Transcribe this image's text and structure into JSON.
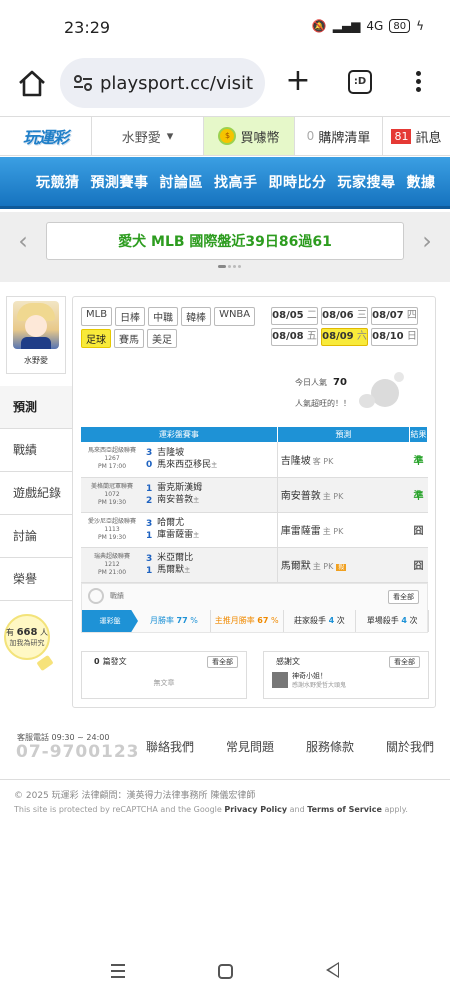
{
  "status": {
    "time": "23:29",
    "battery": "80",
    "net": "4G"
  },
  "browser": {
    "url": "playsport.cc/visit",
    "tabs_label": ":D"
  },
  "header": {
    "logo": "玩運彩",
    "username": "水野愛",
    "buy_coin": "買噱幣",
    "cart_count": "0",
    "cart_label": "購牌清單",
    "msg_count": "81",
    "msg_label": "訊息"
  },
  "nav": [
    "玩競猜",
    "預測賽事",
    "討論區",
    "找高手",
    "即時比分",
    "玩家搜尋",
    "數據"
  ],
  "banner": {
    "text": "愛犬 MLB 國際盤近39日86過61"
  },
  "sidebar": {
    "name": "水野愛",
    "items": [
      "預測",
      "戰績",
      "遊戲紀錄",
      "討論",
      "榮譽"
    ],
    "counter_prefix": "有",
    "counter_value": "668",
    "counter_suffix": "人",
    "counter_line2": "加我為研究"
  },
  "leagues": [
    "MLB",
    "日棒",
    "中職",
    "韓棒",
    "WNBA",
    "足球",
    "賽馬",
    "美足"
  ],
  "active_league": "足球",
  "dates": [
    {
      "date": "08/05",
      "day": "二"
    },
    {
      "date": "08/06",
      "day": "三"
    },
    {
      "date": "08/07",
      "day": "四"
    },
    {
      "date": "08/08",
      "day": "五"
    },
    {
      "date": "08/09",
      "day": "六"
    },
    {
      "date": "08/10",
      "day": "日"
    }
  ],
  "active_date": "08/09",
  "popularity": {
    "label": "今日人氣",
    "value": "70",
    "line2": "人氣超旺的！！"
  },
  "table": {
    "headers": [
      "運彩盤賽事",
      "預測",
      "結果"
    ],
    "rows": [
      {
        "league": "馬來西亞超級聯賽",
        "id": "1267",
        "time": "PM 17:00",
        "s1": "3",
        "s2": "0",
        "t1": "吉隆坡",
        "t2": "馬來西亞移民",
        "t2note": "主",
        "pick": "吉隆坡",
        "pick_note": "客 PK",
        "tag": "",
        "result": "準"
      },
      {
        "league": "美格蘭冠軍聯賽",
        "id": "1072",
        "time": "PM 19:30",
        "s1": "1",
        "s2": "2",
        "t1": "雷克斯漢姆",
        "t2": "南安普敦",
        "t2note": "主",
        "pick": "南安普敦",
        "pick_note": "主 PK",
        "tag": "",
        "result": "準"
      },
      {
        "league": "愛沙尼亞超級聯賽",
        "id": "1113",
        "time": "PM 19:30",
        "s1": "3",
        "s2": "1",
        "t1": "哈爾尤",
        "t2": "庫雷薩雷",
        "t2note": "主",
        "pick": "庫雷薩雷",
        "pick_note": "主 PK",
        "tag": "",
        "result": "囧"
      },
      {
        "league": "瑞典超級聯賽",
        "id": "1212",
        "time": "PM 21:00",
        "s1": "3",
        "s2": "1",
        "t1": "米亞爾比",
        "t2": "馬爾默",
        "t2note": "主",
        "pick": "馬爾默",
        "pick_note": "主 PK",
        "tag": "殺",
        "result": "囧"
      }
    ]
  },
  "stats": {
    "title": "戰績",
    "all": "看全部",
    "label": "運彩盤",
    "cells": [
      {
        "name": "月勝率",
        "value": "77",
        "unit": "%"
      },
      {
        "name": "主推月勝率",
        "value": "67",
        "unit": "%"
      },
      {
        "name": "莊家殺手",
        "value": "4",
        "unit": "次"
      },
      {
        "name": "單場殺手",
        "value": "4",
        "unit": "次"
      }
    ]
  },
  "posts": {
    "count": "0",
    "label": "篇發文",
    "all": "看全部",
    "empty": "無文章"
  },
  "replies": {
    "label": "感謝文",
    "all": "看全部",
    "item_title": "神奇小姐！",
    "item_sub": "感謝水野愛哲大頭鬼"
  },
  "footer": {
    "phone_label": "客服電話 09:30 ~ 24:00",
    "phone": "07-9700123",
    "links": [
      "聯絡我們",
      "常見問題",
      "服務條款",
      "關於我們"
    ],
    "copyright": "© 2025 玩運彩 法律顧問：漢英得力法律事務所 陳儀宏律師",
    "recaptcha_pre": "This site is protected by reCAPTCHA and the Google ",
    "privacy": "Privacy Policy",
    "and": " and ",
    "terms": "Terms of Service",
    "apply": " apply."
  },
  "colors": {
    "brand_blue": "#1e92d6",
    "hit_green": "#29a32b",
    "active_yellow": "#f8ea3a"
  }
}
